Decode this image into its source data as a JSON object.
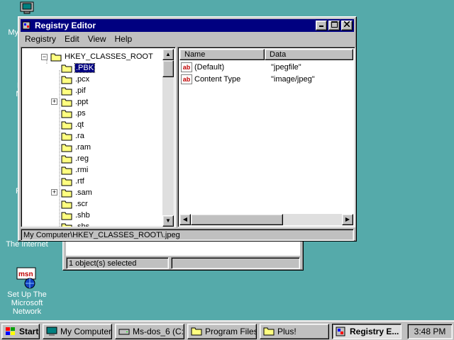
{
  "desktop": {
    "icons": [
      {
        "label": "My"
      },
      {
        "label": "N"
      },
      {
        "label": "Neig"
      },
      {
        "label": "Re"
      },
      {
        "label": "The Internet"
      },
      {
        "label": "Set Up The Microsoft Network"
      }
    ]
  },
  "bg_window": {
    "status": "1 object(s) selected"
  },
  "registry": {
    "title": "Registry Editor",
    "menu": [
      {
        "label": "Registry"
      },
      {
        "label": "Edit"
      },
      {
        "label": "View"
      },
      {
        "label": "Help"
      }
    ],
    "tree": {
      "root": "HKEY_CLASSES_ROOT",
      "items": [
        ".PBK",
        ".pcx",
        ".pif",
        ".ppt",
        ".ps",
        ".qt",
        ".ra",
        ".ram",
        ".reg",
        ".rmi",
        ".rtf",
        ".sam",
        ".scr",
        ".shb",
        ".shs"
      ]
    },
    "list": {
      "columns": [
        "Name",
        "Data"
      ],
      "rows": [
        {
          "name": "(Default)",
          "data": "\"jpegfile\""
        },
        {
          "name": "Content Type",
          "data": "\"image/jpeg\""
        }
      ]
    },
    "status": "My Computer\\HKEY_CLASSES_ROOT\\.jpeg"
  },
  "taskbar": {
    "start": "Start",
    "buttons": [
      {
        "label": "My Computer"
      },
      {
        "label": "Ms-dos_6 (C:)"
      },
      {
        "label": "Program Files"
      },
      {
        "label": "Plus!"
      },
      {
        "label": "Registry E..."
      }
    ],
    "clock": "3:48 PM"
  }
}
